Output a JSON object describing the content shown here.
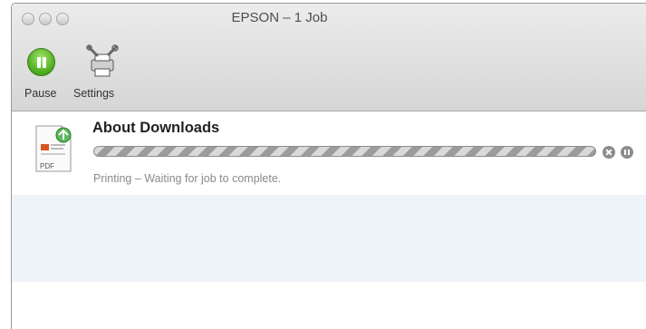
{
  "window": {
    "title": "EPSON – 1 Job"
  },
  "toolbar": {
    "pause_label": "Pause",
    "settings_label": "Settings"
  },
  "job": {
    "name": "About Downloads",
    "doc_icon_text": "PDF",
    "status": "Printing – Waiting for job to complete.",
    "progress_state": "indeterminate"
  },
  "colors": {
    "pause_green": "#4fae1f",
    "status_gray": "#8a8a8a",
    "stripe_blue": "#eef3f8"
  },
  "icons": {
    "pause": "pause-icon",
    "settings": "settings-tools-icon",
    "document": "pdf-document-icon",
    "cancel": "cancel-icon",
    "hold": "hold-icon"
  }
}
